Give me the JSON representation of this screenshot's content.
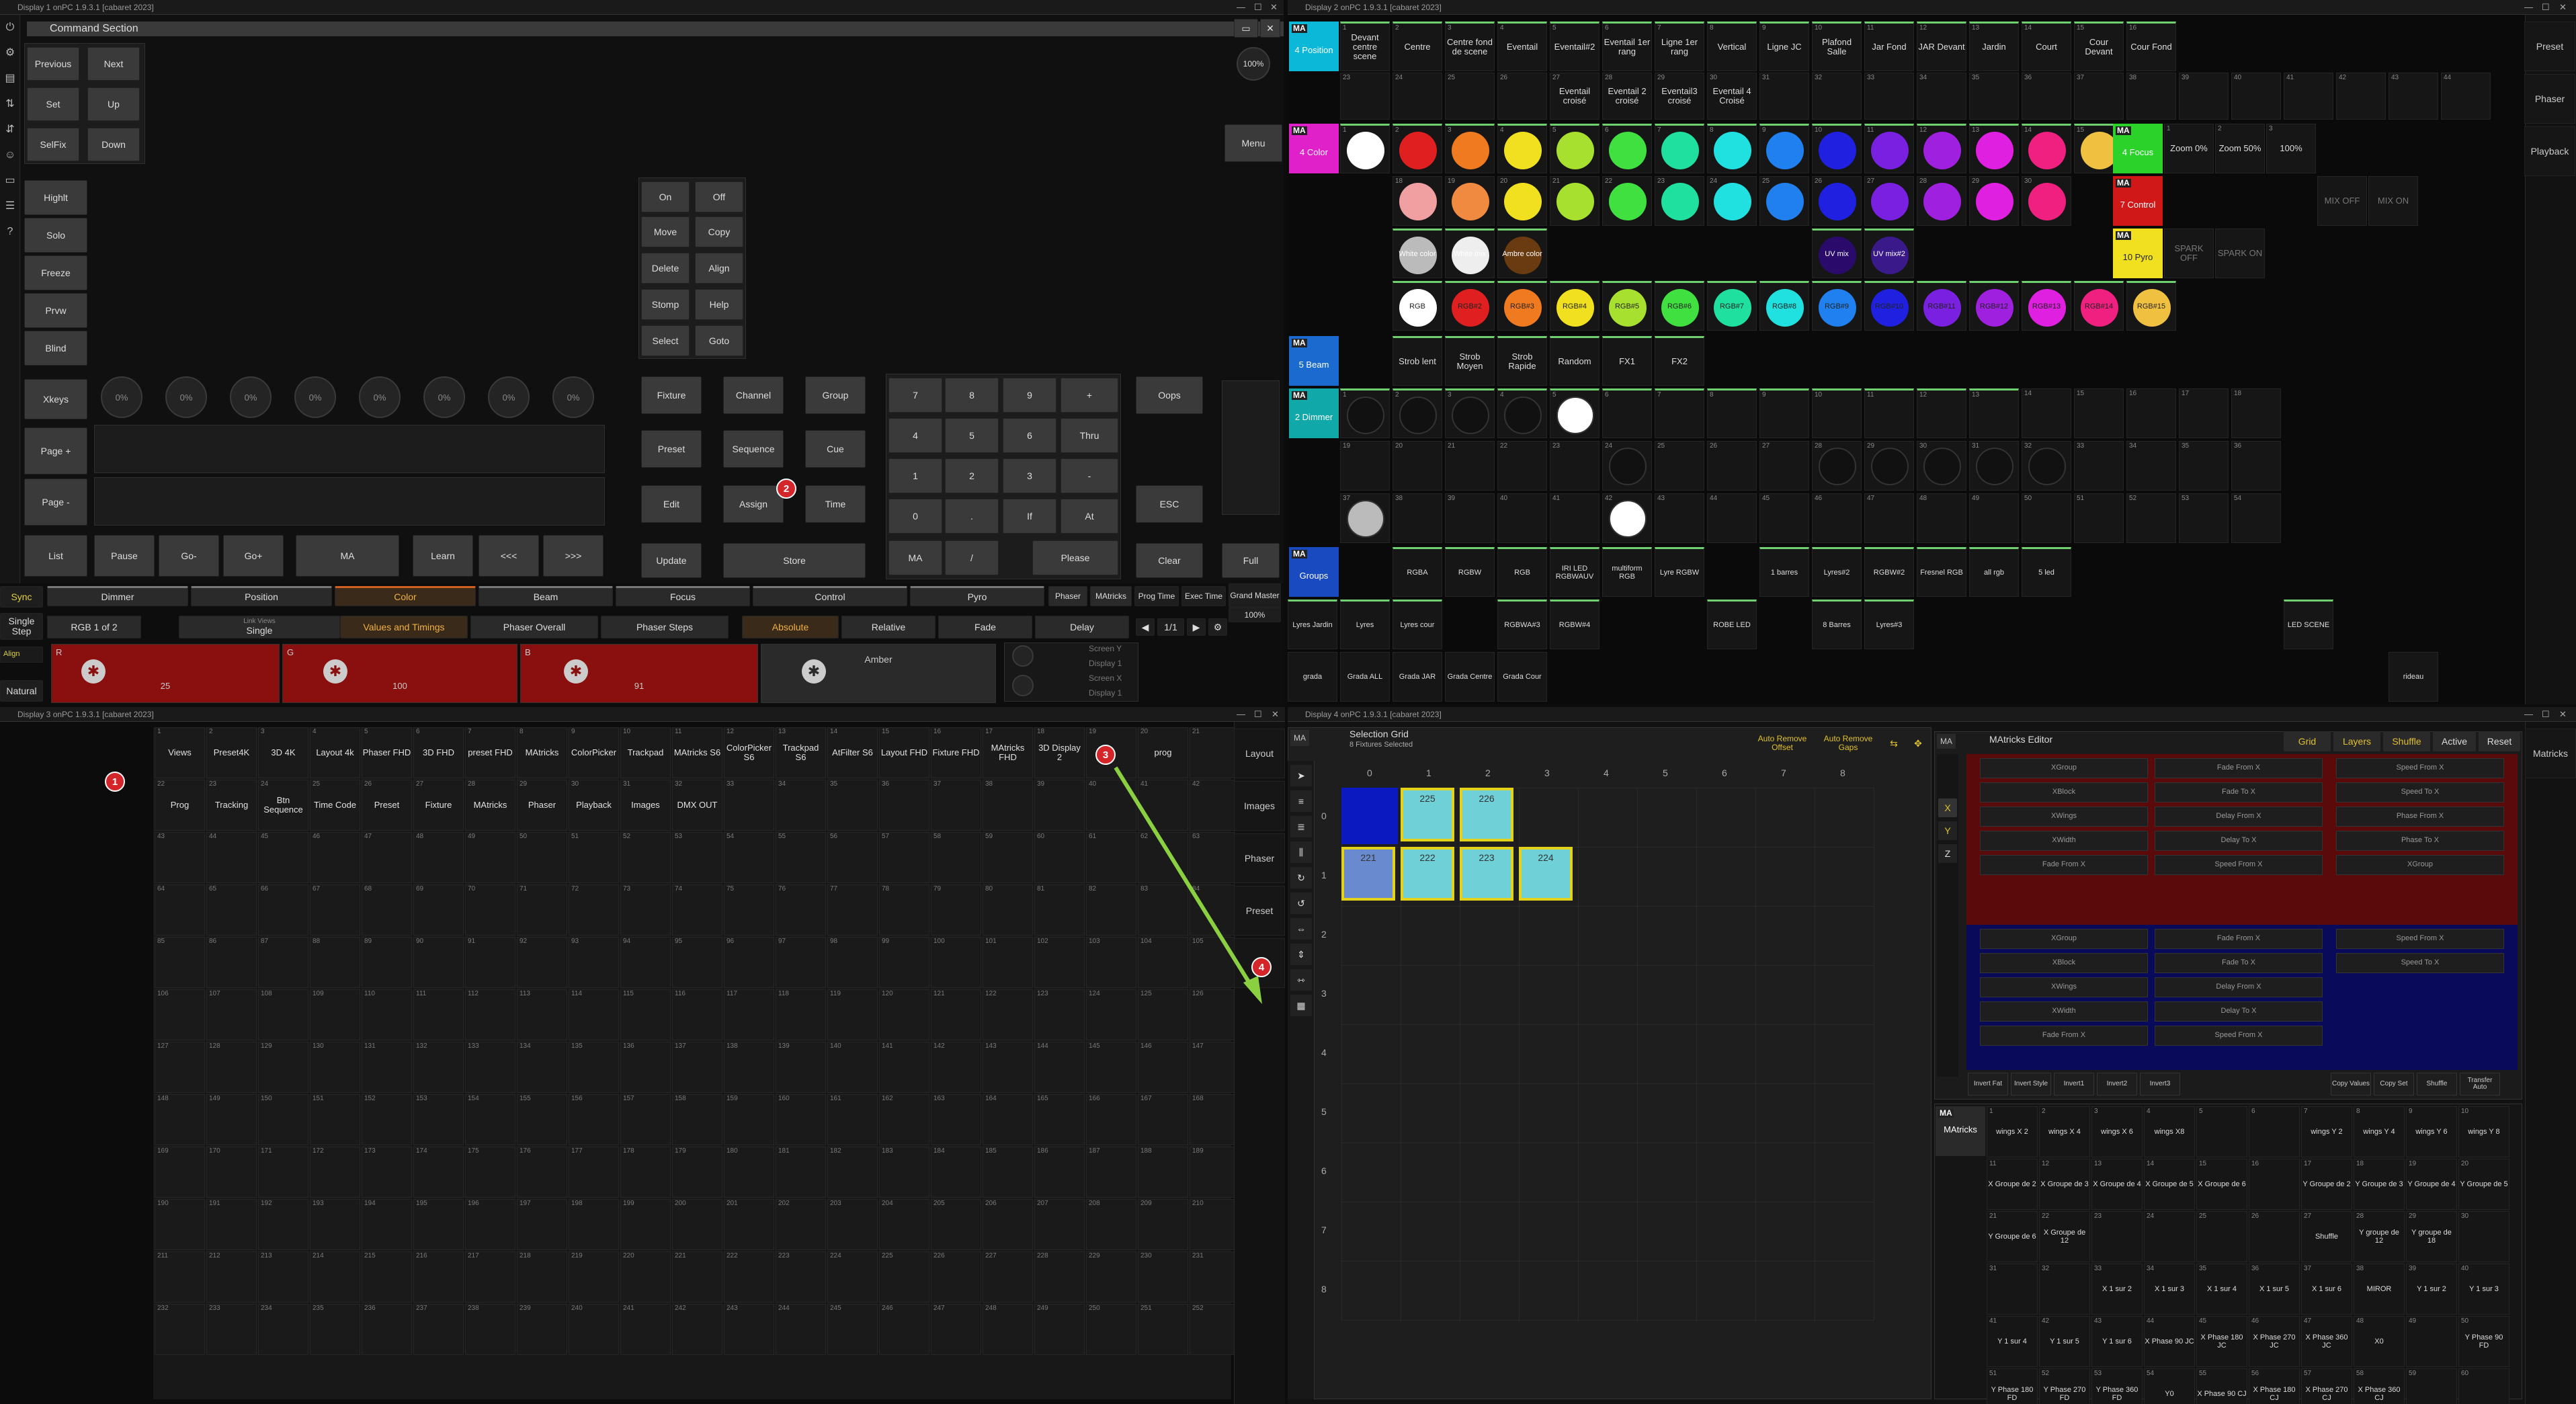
{
  "windows": {
    "d1": "Display 1 onPC 1.9.3.1 [cabaret 2023]",
    "d2": "Display 2 onPC 1.9.3.1 [cabaret 2023]",
    "d3": "Display 3 onPC 1.9.3.1 [cabaret 2023]",
    "d4": "Display 4 onPC 1.9.3.1 [cabaret 2023]"
  },
  "command_section": {
    "title": "Command Section",
    "zoom": "100%",
    "menu": "Menu",
    "nav": [
      "Previous",
      "Next",
      "Set",
      "Up",
      "SelFix",
      "Down"
    ],
    "side": [
      "Highlt",
      "Solo",
      "Freeze",
      "Prvw",
      "Blind"
    ],
    "side2": [
      "Xkeys",
      "Page +",
      "Page -",
      "List"
    ],
    "knobs": [
      "0%",
      "0%",
      "0%",
      "0%",
      "0%",
      "0%",
      "0%",
      "0%"
    ],
    "exec": [
      "Pause",
      "Go-",
      "Go+",
      "MA",
      "Learn",
      "<<<",
      ">>>"
    ],
    "func_left": [
      "On",
      "Off",
      "Move",
      "Copy",
      "Delete",
      "Align",
      "Stomp",
      "Help",
      "Select",
      "Goto"
    ],
    "func_mid": [
      "Fixture",
      "Channel",
      "Group",
      "Preset",
      "Sequence",
      "Cue",
      "Edit",
      "Assign",
      "Time",
      "Update",
      "Store"
    ],
    "numpad": [
      "7",
      "8",
      "9",
      "+",
      "4",
      "5",
      "6",
      "Thru",
      "1",
      "2",
      "3",
      "-",
      "0",
      ".",
      "If",
      "At",
      "MA",
      "/",
      "Please"
    ],
    "oops": "Oops",
    "esc": "ESC",
    "clear": "Clear",
    "full": "Full",
    "marker2": "2"
  },
  "encoder_bar": {
    "sync": "Sync",
    "single_step": "Single Step",
    "align": "Align",
    "natural": "Natural",
    "features": [
      "Dimmer",
      "Position",
      "Color",
      "Beam",
      "Focus",
      "Control",
      "Pyro"
    ],
    "phaser": "Phaser",
    "matricks": "MAtricks",
    "prog_time": "Prog Time",
    "exec_time": "Exec Time",
    "grand_master": "Grand Master",
    "gm_value": "100%",
    "rgb": "RGB 1 of 2",
    "views_label": "Link Views",
    "single": "Single",
    "values_timings": "Values and Timings",
    "phaser_overall": "Phaser Overall",
    "phaser_steps": "Phaser Steps",
    "modes": [
      "Absolute",
      "Relative",
      "Fade",
      "Delay"
    ],
    "page": "1/1",
    "channels": [
      {
        "name": "R",
        "value": "25"
      },
      {
        "name": "G",
        "value": "100"
      },
      {
        "name": "B",
        "value": "91"
      },
      {
        "name": "Amber",
        "value": ""
      }
    ],
    "screen_y": "Screen Y",
    "display1": "Display 1",
    "screen_x": "Screen X",
    "display1b": "Display 1"
  },
  "d2": {
    "right_buttons": [
      "Preset",
      "Phaser",
      "Playback"
    ],
    "position": {
      "label": "4 Position",
      "headers": [
        "Devant centre scene",
        "Centre",
        "Centre fond de scene",
        "Eventail",
        "Eventail#2",
        "Eventail 1er rang",
        "Ligne 1er rang",
        "Vertical",
        "Ligne JC",
        "Plafond Salle",
        "Jar Fond",
        "JAR Devant",
        "Jardin",
        "Court",
        "Cour Devant",
        "Cour Fond"
      ],
      "row2": [
        "Eventail croisé",
        "Eventail 2 croisé",
        "Eventail3 croisé",
        "Eventail 4 Croisé"
      ]
    },
    "color": {
      "label": "4 Color",
      "dots1": [
        "#ffffff",
        "#e02020",
        "#f07a20",
        "#f0e020",
        "#a8e030",
        "#40e040",
        "#20e0a0",
        "#20e0e0",
        "#2080f0",
        "#2020e0",
        "#7a20e0",
        "#a020e0",
        "#e020e0",
        "#f02080",
        "#f0c040"
      ],
      "dots2": [
        "#f0a0a0",
        "#f08a40",
        "#f0e020",
        "#a8e030",
        "#40e040",
        "#20e0a0",
        "#20e0e0",
        "#2080f0",
        "#2020e0",
        "#7a20e0",
        "#a020e0",
        "#e020e0",
        "#f02080"
      ],
      "row3": [
        "White color",
        "White mix",
        "Ambre color",
        "UV mix",
        "UV mix#2"
      ],
      "row4": [
        "RGB",
        "RGB#2",
        "RGB#3",
        "RGB#4",
        "RGB#5",
        "RGB#6",
        "RGB#7",
        "RGB#8",
        "RGB#9",
        "RGB#10",
        "RGB#11",
        "RGB#12",
        "RGB#13",
        "RGB#14",
        "RGB#15"
      ]
    },
    "focus": {
      "label": "4 Focus",
      "items": [
        "Zoom 0%",
        "Zoom 50%",
        "100%"
      ]
    },
    "control": {
      "label": "7 Control",
      "items": [
        "MIX OFF",
        "MIX ON"
      ]
    },
    "pyro": {
      "label": "10 Pyro",
      "items": [
        "SPARK OFF",
        "SPARK ON"
      ]
    },
    "beam": {
      "label": "5 Beam",
      "items": [
        "Strob lent",
        "Strob Moyen",
        "Strob Rapide",
        "Random",
        "FX1",
        "FX2"
      ]
    },
    "dimmer": {
      "label": "2 Dimmer"
    },
    "groups": {
      "label": "Groups",
      "row1": [
        "RGBA",
        "RGBW",
        "RGB",
        "IRI LED RGBWAUV",
        "multiform RGB",
        "Lyre RGBW",
        "1 barres",
        "Lyres#2",
        "RGBW#2",
        "Fresnel RGB",
        "all rgb",
        "5 led"
      ],
      "row2": [
        "Lyres Jardin",
        "Lyres",
        "Lyres cour",
        "RGBWA#3",
        "RGBW#4",
        "ROBE LED",
        "8 Barres",
        "Lyres#3",
        "LED SCENE"
      ],
      "row3": [
        "grada",
        "Grada ALL",
        "Grada JAR",
        "Grada Centre",
        "Grada Cour",
        "rideau"
      ]
    }
  },
  "d3": {
    "views_row1": [
      "Views",
      "Preset4K",
      "3D 4K",
      "Layout 4k",
      "Phaser FHD",
      "3D FHD",
      "preset FHD",
      "MAtricks",
      "ColorPicker",
      "Trackpad",
      "MAtricks S6",
      "ColorPicker S6",
      "Trackpad S6",
      "AtFilter S6",
      "Layout FHD",
      "Fixture FHD",
      "MAtricks FHD",
      "3D Display 2",
      "",
      "prog"
    ],
    "views_row2": [
      "Prog",
      "Tracking",
      "Btn Sequence",
      "Time Code",
      "Preset",
      "Fixture",
      "MAtricks",
      "Phaser",
      "Playback",
      "Images",
      "DMX OUT"
    ],
    "right": [
      "Layout",
      "Images",
      "Phaser",
      "Preset",
      ""
    ],
    "markers": [
      "1",
      "3",
      "4"
    ]
  },
  "d4": {
    "title": "Selection Grid",
    "subtitle": "8 Fixtures Selected",
    "auto_offset": "Auto Remove Offset",
    "auto_gaps": "Auto Remove Gaps",
    "cols": [
      "0",
      "1",
      "2",
      "3",
      "4",
      "5",
      "6",
      "7",
      "8"
    ],
    "rows": [
      "0",
      "1",
      "2",
      "3",
      "4",
      "5",
      "6",
      "7",
      "8"
    ],
    "cells": [
      "225",
      "226",
      "221",
      "222",
      "223",
      "224"
    ],
    "matricks_editor": {
      "title": "MAtricks Editor",
      "tabs": [
        "Grid",
        "Layers",
        "Shuffle",
        "Active",
        "Reset"
      ],
      "axes": [
        "X",
        "Y",
        "Z"
      ],
      "fields": [
        "XGroup",
        "XBlock",
        "XWings",
        "XWidth",
        "Fade From X",
        "Fade To X",
        "Delay From X",
        "Delay To X",
        "Speed From X",
        "Speed To X",
        "Phase From X",
        "Phase To X"
      ],
      "bottom": [
        "Invert Fat",
        "Invert Style",
        "Invert1",
        "Invert2",
        "Invert3",
        "Copy Values",
        "Copy Set",
        "Shuffle",
        "Transfer Auto"
      ]
    },
    "right_btn": "Matricks",
    "matricks_pool": {
      "label": "MAtricks",
      "cells": [
        "wings X 2",
        "wings X 4",
        "wings X 6",
        "wings X8",
        "",
        "",
        "wings Y 2",
        "wings Y 4",
        "wings Y 6",
        "wings Y 8",
        "X Groupe de 2",
        "X Groupe de 3",
        "X Groupe de 4",
        "X Groupe de 5",
        "X Groupe de 6",
        "",
        "Y Groupe de 2",
        "Y Groupe de 3",
        "Y Groupe de 4",
        "Y Groupe de 5",
        "Y Groupe de 6",
        "X Groupe de 12",
        "",
        "",
        "",
        "",
        "Shuffle",
        "Y groupe de 12",
        "Y groupe de 18",
        "",
        "",
        "",
        "X 1 sur 2",
        "X 1 sur 3",
        "X 1 sur 4",
        "X 1 sur 5",
        "X 1 sur 6",
        "MIROR",
        "Y 1 sur 2",
        "Y 1 sur 3",
        "Y 1 sur 4",
        "Y 1 sur 5",
        "Y 1 sur 6",
        "X Phase 90 JC",
        "X Phase 180 JC",
        "X Phase 270 JC",
        "X Phase 360 JC",
        "X0",
        "",
        "Y Phase 90 FD",
        "Y Phase 180 FD",
        "Y Phase 270 FD",
        "Y Phase 360 FD",
        "Y0",
        "X Phase 90 CJ",
        "X Phase 180 CJ",
        "X Phase 270 CJ",
        "X Phase 360 CJ",
        "",
        "",
        "Y Phase 90 DF",
        "Y Phase 180 DF",
        "Y Phase 270 DF",
        "Y Phase 360 DF",
        ""
      ]
    }
  }
}
